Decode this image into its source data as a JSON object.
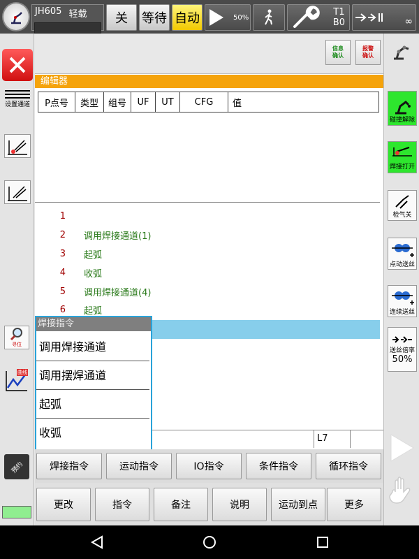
{
  "topbar": {
    "robot_model": "JH605",
    "load_label": "轻载",
    "power_label": "关",
    "wait_label": "等待",
    "mode_label": "自动",
    "speed_percent": "50%",
    "t_label": "T1",
    "b_label": "B0",
    "infinity_label": "∞"
  },
  "message_buttons": {
    "info_confirm": "信息确认",
    "alarm_confirm": "报警确认"
  },
  "left_rail": {
    "set_channel": "设置通道",
    "find_label": "寻位",
    "curve_label": "曲线",
    "reserve_label": "预约"
  },
  "right_rail": {
    "collision_release": "碰撞解除",
    "weld_open": "焊接打开",
    "gas_check": "检气关",
    "inch_feed": "点动送丝",
    "continuous_feed": "连续送丝",
    "feed_rate_label": "送丝倍率",
    "feed_rate_value": "50%"
  },
  "editor": {
    "title": "编辑器",
    "columns": [
      "P点号",
      "类型",
      "组号",
      "UF",
      "UT",
      "CFG",
      "值"
    ]
  },
  "program_lines": [
    {
      "num": "1",
      "text": ""
    },
    {
      "num": "2",
      "text": "调用焊接通道(1)"
    },
    {
      "num": "3",
      "text": "起弧"
    },
    {
      "num": "4",
      "text": "收弧"
    },
    {
      "num": "5",
      "text": "调用焊接通道(4)"
    },
    {
      "num": "6",
      "text": "起弧"
    }
  ],
  "status": {
    "line_indicator": "L7"
  },
  "popup": {
    "title": "焊接指令",
    "items": [
      "调用焊接通道",
      "调用摆焊通道",
      "起弧",
      "收弧"
    ]
  },
  "instruction_tabs": [
    "焊接指令",
    "运动指令",
    "IO指令",
    "条件指令",
    "循环指令"
  ],
  "action_buttons": [
    "更改",
    "指令",
    "备注",
    "说明",
    "运动到点",
    "更多"
  ],
  "colors": {
    "editor_header": "#f5a30b",
    "selected_row": "#87ceeb",
    "line_number": "#a00000",
    "instruction_text": "#2a7a1a",
    "popup_border": "#29a3d9"
  }
}
